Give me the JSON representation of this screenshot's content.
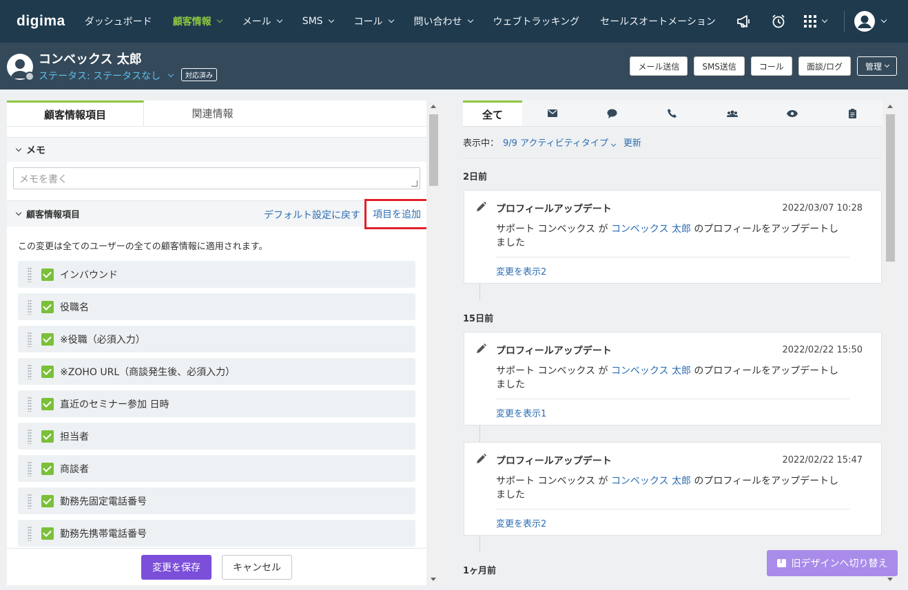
{
  "nav": {
    "logo": "digima",
    "items": [
      {
        "label": "ダッシュボード",
        "dropdown": false,
        "active": false
      },
      {
        "label": "顧客情報",
        "dropdown": true,
        "active": true
      },
      {
        "label": "メール",
        "dropdown": true,
        "active": false
      },
      {
        "label": "SMS",
        "dropdown": true,
        "active": false
      },
      {
        "label": "コール",
        "dropdown": true,
        "active": false
      },
      {
        "label": "問い合わせ",
        "dropdown": true,
        "active": false
      },
      {
        "label": "ウェブトラッキング",
        "dropdown": false,
        "active": false
      },
      {
        "label": "セールスオートメーション",
        "dropdown": false,
        "active": false
      }
    ],
    "icons": [
      "megaphone-icon",
      "alarm-clock-icon",
      "apps-grid-icon",
      "user-avatar-icon"
    ]
  },
  "header": {
    "name": "コンベックス 太郎",
    "status": "ステータス: ステータスなし",
    "badge": "対応済み",
    "buttons": {
      "mail": "メール送信",
      "sms": "SMS送信",
      "call": "コール",
      "log": "面談/ログ",
      "manage": "管理"
    }
  },
  "left": {
    "tabs": {
      "fields": "顧客情報項目",
      "related": "関連情報"
    },
    "memo": {
      "title": "メモ",
      "placeholder": "メモを書く"
    },
    "custom": {
      "title": "顧客情報項目",
      "reset": "デフォルト設定に戻す",
      "add": "項目を追加",
      "note": "この変更は全てのユーザーの全ての顧客情報に適用されます。",
      "items": [
        "インバウンド",
        "役職名",
        "※役職（必須入力）",
        "※ZOHO URL（商談発生後、必須入力）",
        "直近のセミナー参加 日時",
        "担当者",
        "商談者",
        "勤務先固定電話番号",
        "勤務先携帯電話番号"
      ]
    },
    "save": "変更を保存",
    "cancel": "キャンセル"
  },
  "right": {
    "tabs": {
      "all": "全て",
      "icons": [
        "mail-icon",
        "chat-icon",
        "phone-icon",
        "group-icon",
        "eye-icon",
        "clipboard-icon"
      ]
    },
    "filter": {
      "prefix": "表示中：",
      "value": "9/9 アクティビティタイプ",
      "refresh": "更新"
    },
    "groups": [
      {
        "label": "2日前",
        "cards": [
          {
            "title": "プロフィールアップデート",
            "date": "2022/03/07 10:28",
            "actor": "サポート コンベックス が ",
            "target": "コンベックス 太郎",
            "rest": " のプロフィールをアップデートしました",
            "link": "変更を表示2"
          }
        ]
      },
      {
        "label": "15日前",
        "cards": [
          {
            "title": "プロフィールアップデート",
            "date": "2022/02/22 15:50",
            "actor": "サポート コンベックス が ",
            "target": "コンベックス 太郎",
            "rest": " のプロフィールをアップデートしました",
            "link": "変更を表示1"
          },
          {
            "title": "プロフィールアップデート",
            "date": "2022/02/22 15:47",
            "actor": "サポート コンベックス が ",
            "target": "コンベックス 太郎",
            "rest": " のプロフィールをアップデートしました",
            "link": "変更を表示2"
          }
        ]
      },
      {
        "label": "1ヶ月前",
        "cards": []
      }
    ]
  },
  "old_design": "旧デザインへ切り替え",
  "colors": {
    "nav_bg": "#1f3a4d",
    "header_bg": "#34495a",
    "accent_green": "#8cc63f",
    "link_blue": "#2c6db3",
    "save_purple": "#7b4fd9",
    "highlight_red": "#e0202a"
  }
}
